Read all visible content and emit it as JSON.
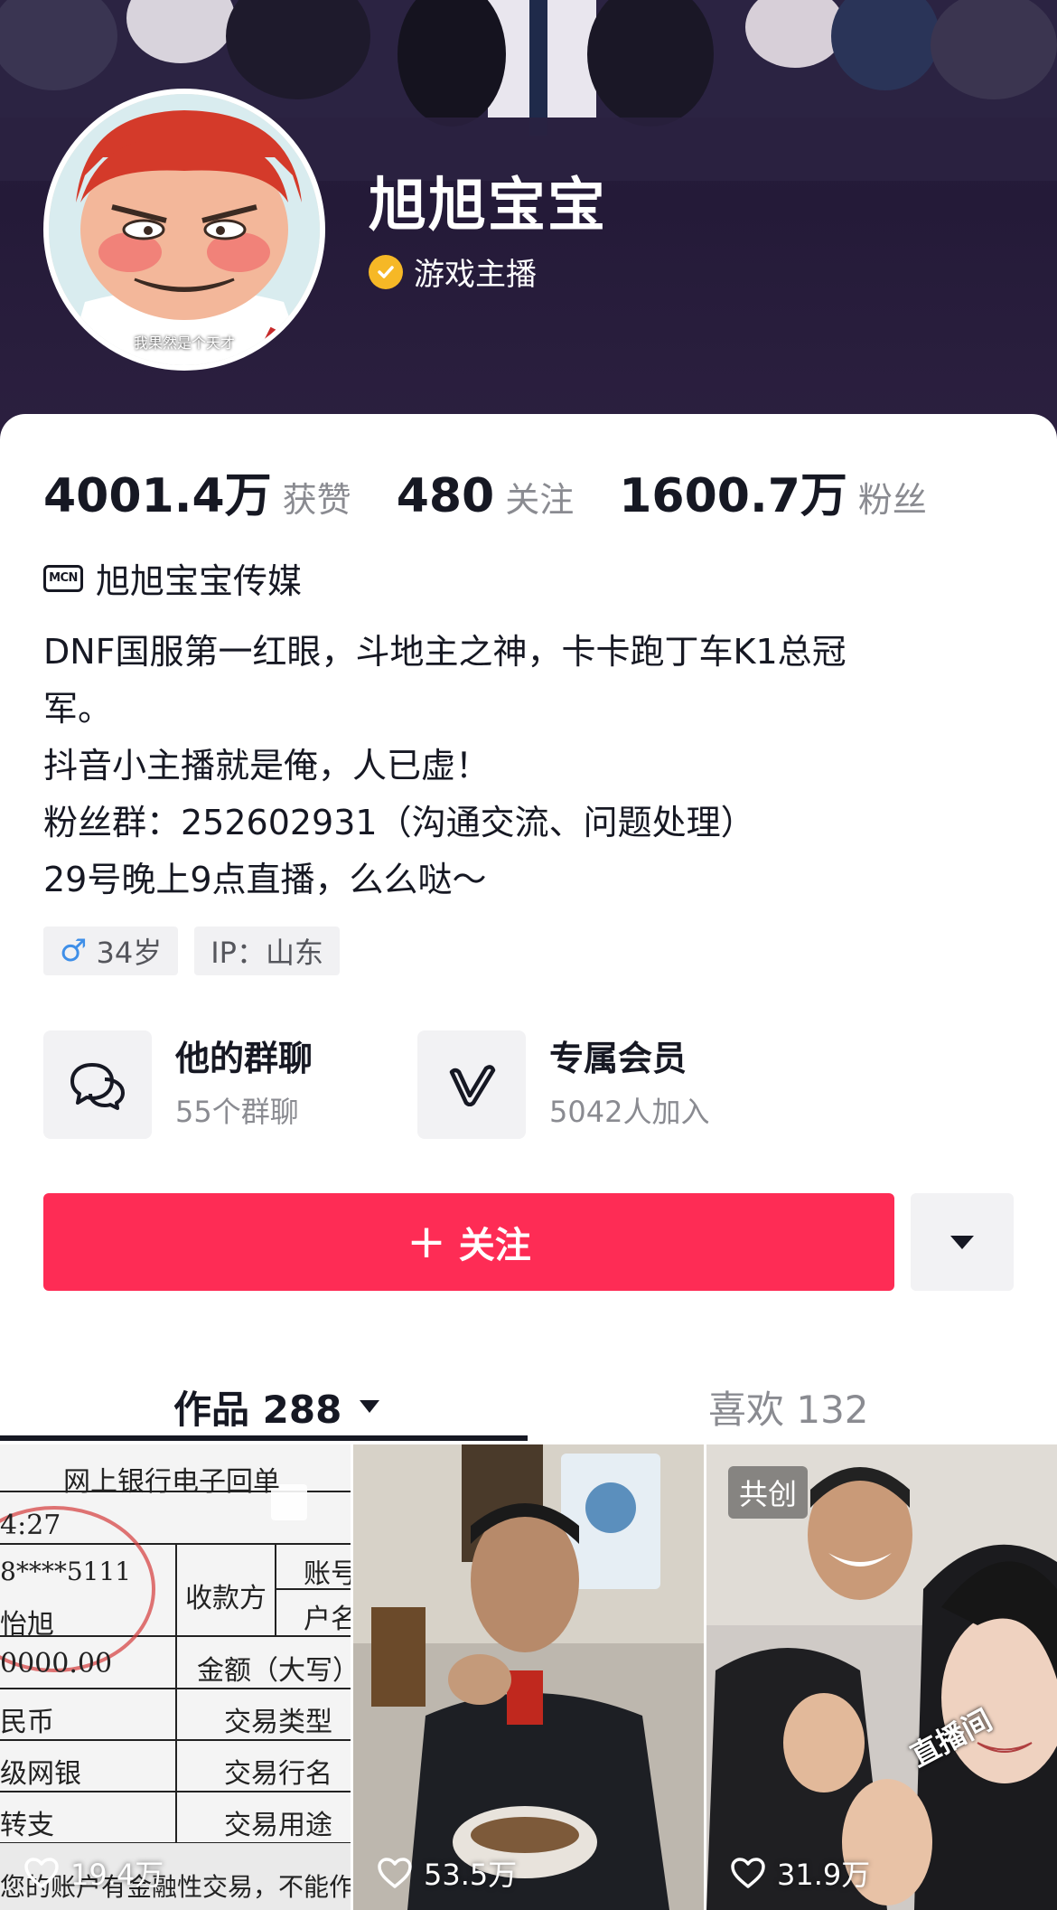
{
  "profile": {
    "nickname": "旭旭宝宝",
    "verify_label": "游戏主播",
    "avatar_caption": "我果然是个天才"
  },
  "stats": [
    {
      "value": "4001.4万",
      "label": "获赞"
    },
    {
      "value": "480",
      "label": "关注"
    },
    {
      "value": "1600.7万",
      "label": "粉丝"
    }
  ],
  "mcn": {
    "icon_text": "MCN",
    "name": "旭旭宝宝传媒"
  },
  "bio": {
    "lines": [
      "DNF国服第一红眼，斗地主之神，卡卡跑丁车K1总冠",
      "军。",
      "抖音小主播就是俺，人已虚！",
      "粉丝群：252602931（沟通交流、问题处理）",
      "29号晚上9点直播，么么哒～"
    ]
  },
  "tags": {
    "gender_symbol": "♂",
    "age": "34岁",
    "ip": "IP：山东"
  },
  "features": [
    {
      "title": "他的群聊",
      "subtitle": "55个群聊",
      "icon": "chat-bubbles-icon"
    },
    {
      "title": "专属会员",
      "subtitle": "5042人加入",
      "icon": "membership-v-icon"
    }
  ],
  "actions": {
    "follow_plus": "+",
    "follow_label": "关注",
    "more_icon": "caret-down-icon"
  },
  "tabs": {
    "works": "作品 288",
    "likes": "喜欢 132"
  },
  "videos": [
    {
      "likes": "19.4万",
      "receipt": {
        "title": "网上银行电子回单",
        "time": "4:27",
        "account": "8****5111",
        "name": "怡旭",
        "payee": "收款方",
        "account_no": "账号",
        "account_name": "户名",
        "amount_zero": "0000.00",
        "amount_label": "金额（大写）",
        "currency": "民币",
        "txn_type": "交易类型",
        "level": "级网银",
        "txn_bank": "交易行名",
        "transfer": "转支",
        "txn_use": "交易用途",
        "footer": "您的账户有金融性交易，不能作"
      }
    },
    {
      "likes": "53.5万"
    },
    {
      "likes": "31.9万",
      "badge": "共创",
      "sticker": "直播间"
    }
  ],
  "colors": {
    "accent": "#fe2c55",
    "verify": "#f6b826",
    "text_primary": "#161823",
    "text_secondary": "#8a8b91",
    "banner": "#2a2140"
  }
}
